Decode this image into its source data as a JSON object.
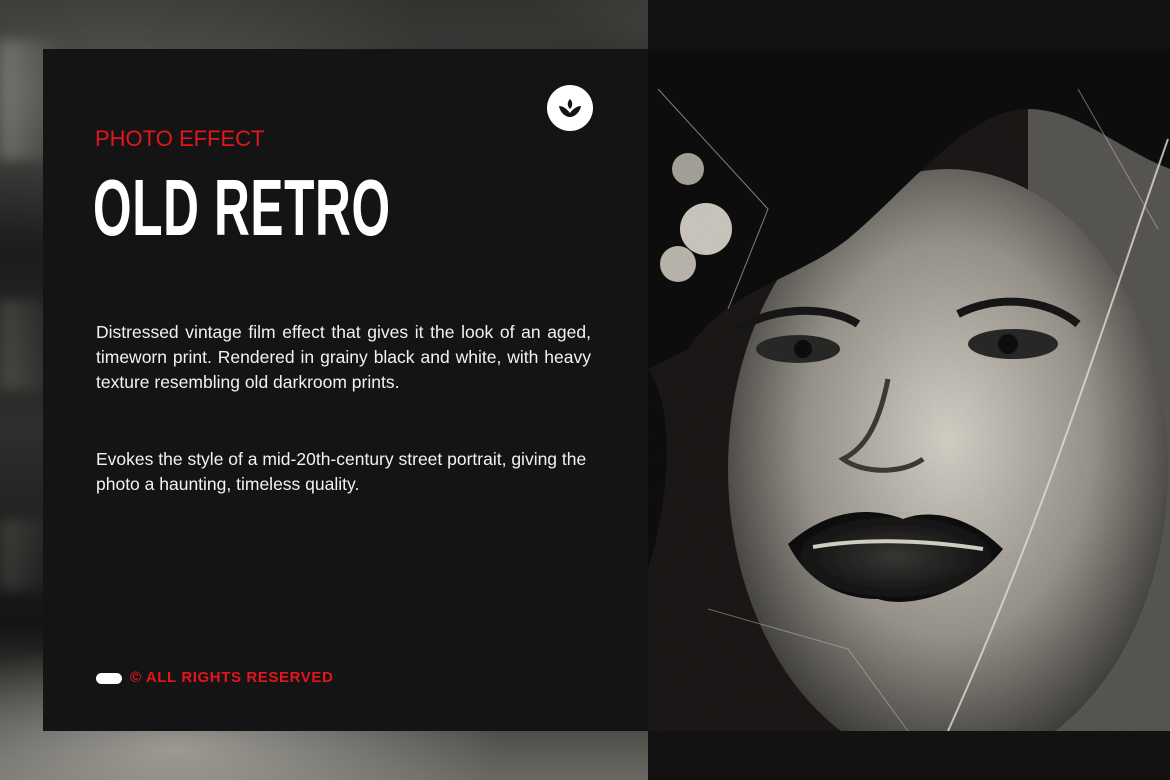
{
  "card": {
    "kicker": "PHOTO EFFECT",
    "title": "OLD RETRO",
    "paragraphs": [
      "Distressed vintage film effect that gives it the look of an aged, timeworn print. Rendered in grainy black and white, with heavy texture resembling old darkroom prints.",
      "Evokes the style of a mid-20th-century street portrait, giving the photo a haunting, timeless quality."
    ],
    "footer": "© ALL RIGHTS RESERVED"
  },
  "icons": {
    "logo": "brand-logo-icon",
    "pill": "pill-icon"
  },
  "colors": {
    "accent": "#e3161b",
    "panel": "#141414",
    "text": "#ffffff"
  }
}
